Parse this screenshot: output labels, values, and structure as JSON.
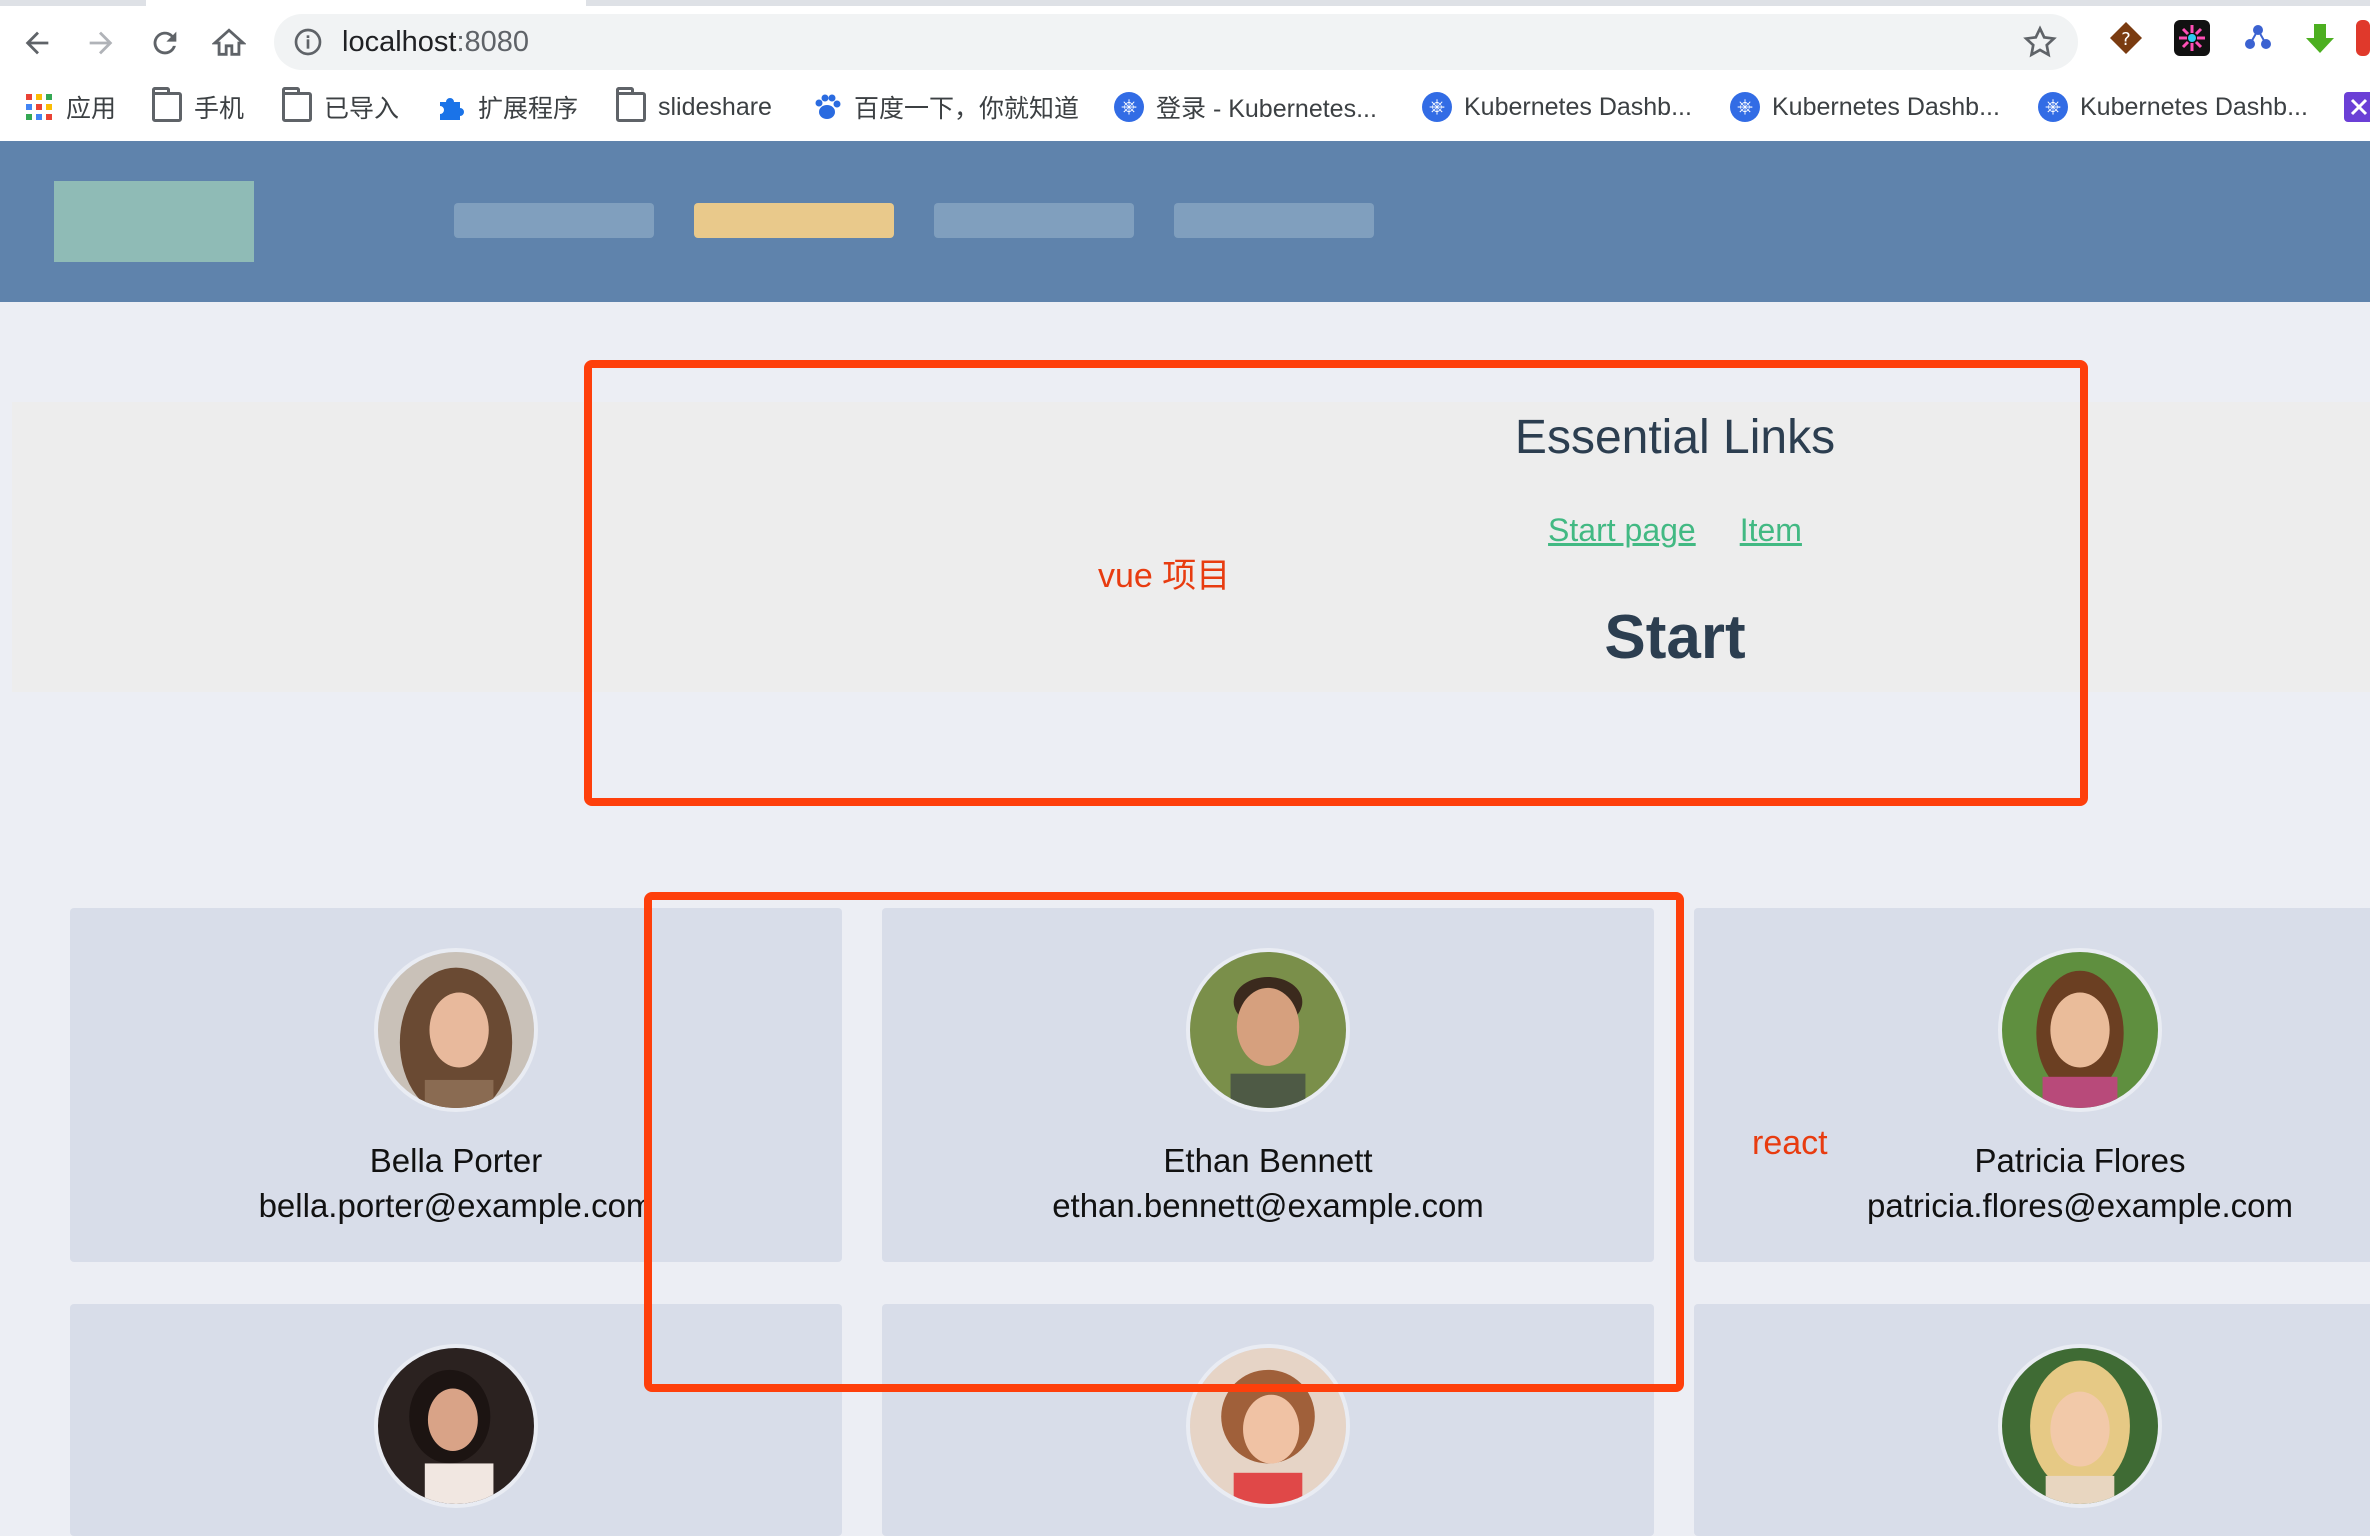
{
  "browser": {
    "url_host": "localhost",
    "url_port": ":8080",
    "bookmarks": [
      {
        "label": "应用",
        "icon": "apps-grid-icon"
      },
      {
        "label": "手机",
        "icon": "folder-icon"
      },
      {
        "label": "已导入",
        "icon": "folder-icon"
      },
      {
        "label": "扩展程序",
        "icon": "puzzle-icon"
      },
      {
        "label": "slideshare",
        "icon": "folder-icon"
      },
      {
        "label": "百度一下，你就知道",
        "icon": "baidu-paw-icon"
      },
      {
        "label": "登录 - Kubernetes...",
        "icon": "kubernetes-icon"
      },
      {
        "label": "Kubernetes Dashb...",
        "icon": "kubernetes-icon"
      },
      {
        "label": "Kubernetes Dashb...",
        "icon": "kubernetes-icon"
      },
      {
        "label": "Kubernetes Dashb...",
        "icon": "kubernetes-icon"
      }
    ]
  },
  "vue": {
    "annotation": "vue 项目",
    "title": "Essential Links",
    "links": [
      "Start page",
      "Item"
    ],
    "heading": "Start"
  },
  "react": {
    "annotation": "react",
    "contacts": [
      {
        "name": "Bella Porter",
        "email": "bella.porter@example.com"
      },
      {
        "name": "Ethan Bennett",
        "email": "ethan.bennett@example.com"
      },
      {
        "name": "Patricia Flores",
        "email": "patricia.flores@example.com"
      }
    ]
  },
  "colors": {
    "app_header": "#5f83ac",
    "nav_active": "#e9c98b",
    "link": "#42b983",
    "highlight": "#fe3f0b",
    "card": "#d8dde9"
  }
}
